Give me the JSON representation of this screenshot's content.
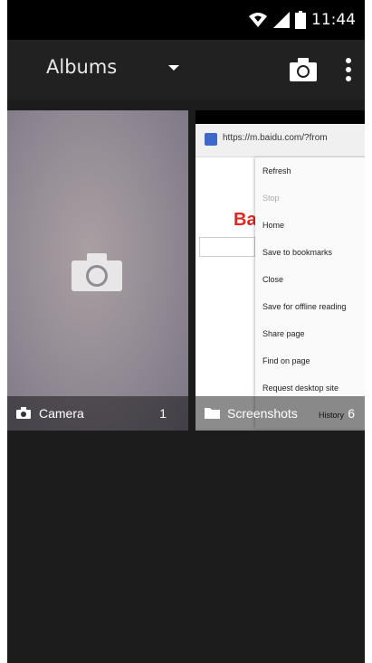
{
  "status_bar": {
    "time": "11:44"
  },
  "app_bar": {
    "title": "Albums"
  },
  "albums": [
    {
      "name": "Camera",
      "count": "1"
    },
    {
      "name": "Screenshots",
      "count": "6"
    }
  ],
  "screenshot_thumb": {
    "url": "https://m.baidu.com/?from",
    "page_logo": "Ba",
    "menu": [
      "Refresh",
      "Stop",
      "Home",
      "Save to bookmarks",
      "Close",
      "Save for offline reading",
      "Share page",
      "Find on page",
      "Request desktop site",
      "History"
    ]
  },
  "colors": {
    "background": "#1c1c1c",
    "app_bar": "#212121",
    "status_bar": "#000000"
  }
}
